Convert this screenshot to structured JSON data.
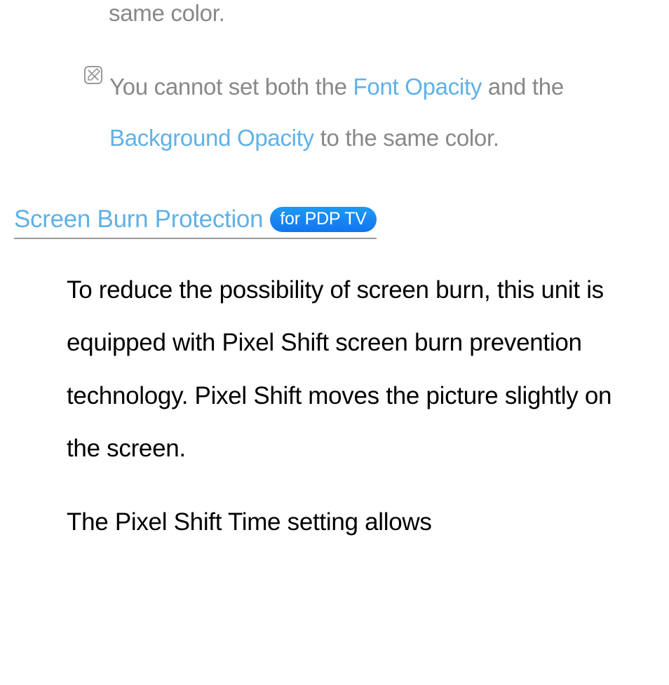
{
  "fragment": "same color.",
  "note": {
    "pre": "You cannot set both the ",
    "font_opacity": "Font Opacity",
    "mid": " and the ",
    "bg_opacity": "Background Opacity",
    "post": " to the same color.",
    "icon_name": "note-icon"
  },
  "section": {
    "title": "Screen Burn Protection",
    "badge": "for PDP TV"
  },
  "body": {
    "p1": "To reduce the possibility of screen burn, this unit is equipped with Pixel Shift screen burn prevention technology. Pixel Shift moves the picture slightly on the screen.",
    "p2": "The Pixel Shift Time setting allows"
  }
}
